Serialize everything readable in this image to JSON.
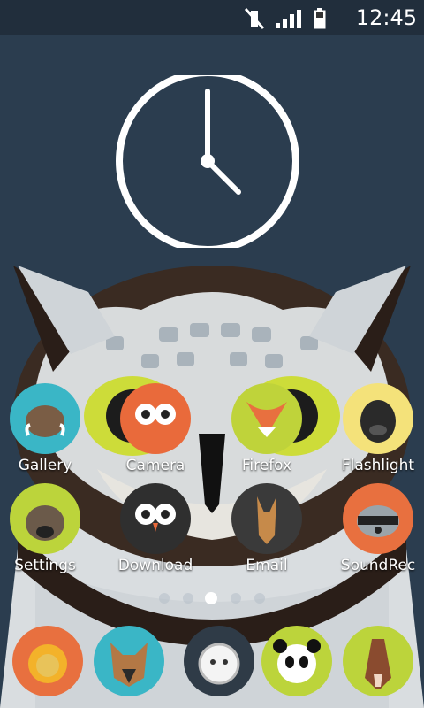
{
  "status_bar": {
    "time": "12:45",
    "icons": [
      "mute-icon",
      "signal-icon",
      "battery-icon"
    ]
  },
  "clock_widget": {
    "hour": 5,
    "minute": 0
  },
  "rows": [
    [
      {
        "label": "Gallery",
        "icon": "warthog-icon",
        "bg": "#3ab6c6"
      },
      {
        "label": "Camera",
        "icon": "owl-icon",
        "bg": "#e96a3b"
      },
      {
        "label": "Firefox",
        "icon": "fox-icon",
        "bg": "#bfd33a"
      },
      {
        "label": "Flashlight",
        "icon": "gorilla-icon",
        "bg": "#f4e27a"
      }
    ],
    [
      {
        "label": "Settings",
        "icon": "hyena-icon",
        "bg": "#bcd43b"
      },
      {
        "label": "Download",
        "icon": "barn-owl-icon",
        "bg": "#2f2f2f"
      },
      {
        "label": "Email",
        "icon": "kangaroo-icon",
        "bg": "#3a3a3a"
      },
      {
        "label": "SoundRec",
        "icon": "raccoon-icon",
        "bg": "#e8703f"
      }
    ]
  ],
  "page_indicator": {
    "count": 5,
    "active": 2
  },
  "dock": [
    {
      "icon": "lion-icon",
      "bg": "#e8703f"
    },
    {
      "icon": "dog-icon",
      "bg": "#3ab6c6"
    },
    {
      "icon": "sheep-icon",
      "bg": "#2f3b47"
    },
    {
      "icon": "panda-icon",
      "bg": "#bcd43b"
    },
    {
      "icon": "horse-icon",
      "bg": "#bcd43b"
    }
  ]
}
